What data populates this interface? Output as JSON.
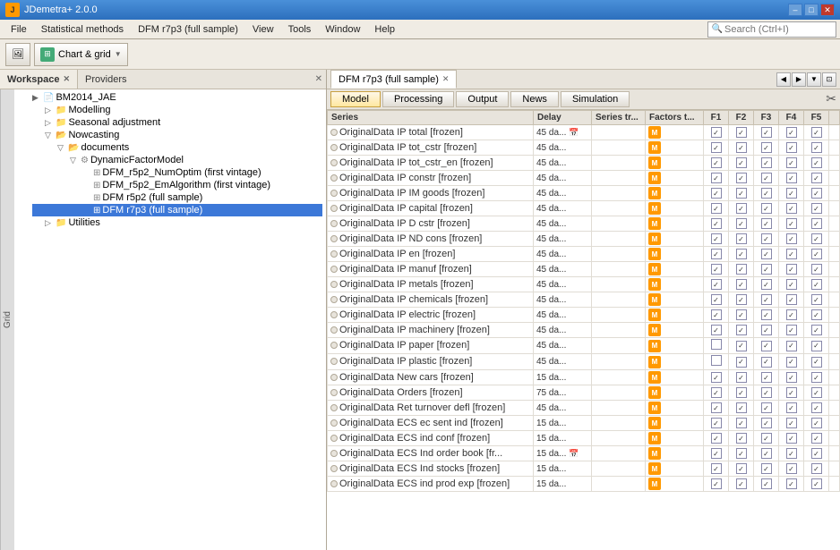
{
  "titleBar": {
    "title": "JDemetra+ 2.0.0",
    "minLabel": "–",
    "maxLabel": "□",
    "closeLabel": "✕"
  },
  "menuBar": {
    "items": [
      "File",
      "Statistical methods",
      "DFM r7p3 (full sample)",
      "View",
      "Tools",
      "Window",
      "Help"
    ],
    "searchPlaceholder": "Search (Ctrl+I)"
  },
  "toolbar": {
    "btnLabel": "Chart & grid",
    "dropdownArrow": "▼"
  },
  "leftPanel": {
    "tab1": "Workspace",
    "tab2": "Providers",
    "gridLabel": "Grid",
    "tree": [
      {
        "id": "bm2014",
        "label": "BM2014_JAE",
        "level": 0,
        "type": "folder",
        "expanded": true
      },
      {
        "id": "modelling",
        "label": "Modelling",
        "level": 1,
        "type": "folder",
        "expanded": true
      },
      {
        "id": "seasonal",
        "label": "Seasonal adjustment",
        "level": 1,
        "type": "folder",
        "expanded": false
      },
      {
        "id": "nowcasting",
        "label": "Nowcasting",
        "level": 1,
        "type": "folder",
        "expanded": true
      },
      {
        "id": "documents",
        "label": "documents",
        "level": 2,
        "type": "folder",
        "expanded": true
      },
      {
        "id": "dfm",
        "label": "DynamicFactorModel",
        "level": 3,
        "type": "folder",
        "expanded": true
      },
      {
        "id": "dfm1",
        "label": "DFM_r5p2_NumOptim (first vintage)",
        "level": 4,
        "type": "doc"
      },
      {
        "id": "dfm2",
        "label": "DFM_r5p2_EmAlgorithm (first vintage)",
        "level": 4,
        "type": "doc"
      },
      {
        "id": "dfm3",
        "label": "DFM r5p2 (full sample)",
        "level": 4,
        "type": "doc"
      },
      {
        "id": "dfm4",
        "label": "DFM r7p3 (full sample)",
        "level": 4,
        "type": "doc",
        "selected": true
      },
      {
        "id": "utilities",
        "label": "Utilities",
        "level": 1,
        "type": "folder",
        "expanded": false
      }
    ]
  },
  "rightPanel": {
    "docTab": "DFM r7p3 (full sample)",
    "contentTabs": [
      "Model",
      "Processing",
      "Output",
      "News",
      "Simulation"
    ],
    "activeContentTab": "Model",
    "tableHeaders": [
      "Series",
      "Delay",
      "Series tr...",
      "Factors t...",
      "F1",
      "F2",
      "F3",
      "F4",
      "F5"
    ],
    "rows": [
      {
        "series": "OriginalData IP total [frozen]",
        "delay": "45 da...",
        "hasCal": true,
        "f1": true,
        "f2": true,
        "f3": true,
        "f4": true,
        "f5": true
      },
      {
        "series": "OriginalData IP tot_cstr [frozen]",
        "delay": "45 da...",
        "hasCal": false,
        "f1": true,
        "f2": true,
        "f3": true,
        "f4": true,
        "f5": true
      },
      {
        "series": "OriginalData IP tot_cstr_en [frozen]",
        "delay": "45 da...",
        "hasCal": false,
        "f1": true,
        "f2": true,
        "f3": true,
        "f4": true,
        "f5": true
      },
      {
        "series": "OriginalData IP constr [frozen]",
        "delay": "45 da...",
        "hasCal": false,
        "f1": true,
        "f2": true,
        "f3": true,
        "f4": true,
        "f5": true
      },
      {
        "series": "OriginalData IP IM goods [frozen]",
        "delay": "45 da...",
        "hasCal": false,
        "f1": true,
        "f2": true,
        "f3": true,
        "f4": true,
        "f5": true
      },
      {
        "series": "OriginalData IP capital [frozen]",
        "delay": "45 da...",
        "hasCal": false,
        "f1": true,
        "f2": true,
        "f3": true,
        "f4": true,
        "f5": true
      },
      {
        "series": "OriginalData IP D cstr [frozen]",
        "delay": "45 da...",
        "hasCal": false,
        "f1": true,
        "f2": true,
        "f3": true,
        "f4": true,
        "f5": true
      },
      {
        "series": "OriginalData IP ND cons [frozen]",
        "delay": "45 da...",
        "hasCal": false,
        "f1": true,
        "f2": true,
        "f3": true,
        "f4": true,
        "f5": true
      },
      {
        "series": "OriginalData IP en [frozen]",
        "delay": "45 da...",
        "hasCal": false,
        "f1": true,
        "f2": true,
        "f3": true,
        "f4": true,
        "f5": true
      },
      {
        "series": "OriginalData IP manuf [frozen]",
        "delay": "45 da...",
        "hasCal": false,
        "f1": true,
        "f2": true,
        "f3": true,
        "f4": true,
        "f5": true
      },
      {
        "series": "OriginalData IP metals [frozen]",
        "delay": "45 da...",
        "hasCal": false,
        "f1": true,
        "f2": true,
        "f3": true,
        "f4": true,
        "f5": true
      },
      {
        "series": "OriginalData IP chemicals [frozen]",
        "delay": "45 da...",
        "hasCal": false,
        "f1": true,
        "f2": true,
        "f3": true,
        "f4": true,
        "f5": true
      },
      {
        "series": "OriginalData IP electric  [frozen]",
        "delay": "45 da...",
        "hasCal": false,
        "f1": true,
        "f2": true,
        "f3": true,
        "f4": true,
        "f5": true
      },
      {
        "series": "OriginalData IP machinery [frozen]",
        "delay": "45 da...",
        "hasCal": false,
        "f1": true,
        "f2": true,
        "f3": true,
        "f4": true,
        "f5": true
      },
      {
        "series": "OriginalData IP paper [frozen]",
        "delay": "45 da...",
        "hasCal": false,
        "f1": false,
        "f2": true,
        "f3": true,
        "f4": true,
        "f5": true
      },
      {
        "series": "OriginalData IP plastic [frozen]",
        "delay": "45 da...",
        "hasCal": false,
        "f1": false,
        "f2": true,
        "f3": true,
        "f4": true,
        "f5": true
      },
      {
        "series": "OriginalData New cars [frozen]",
        "delay": "15 da...",
        "hasCal": false,
        "f1": true,
        "f2": true,
        "f3": true,
        "f4": true,
        "f5": true
      },
      {
        "series": "OriginalData Orders [frozen]",
        "delay": "75 da...",
        "hasCal": false,
        "f1": true,
        "f2": true,
        "f3": true,
        "f4": true,
        "f5": true
      },
      {
        "series": "OriginalData Ret turnover defl [frozen]",
        "delay": "45 da...",
        "hasCal": false,
        "f1": true,
        "f2": true,
        "f3": true,
        "f4": true,
        "f5": true
      },
      {
        "series": "OriginalData ECS ec sent ind [frozen]",
        "delay": "15 da...",
        "hasCal": false,
        "f1": true,
        "f2": true,
        "f3": true,
        "f4": true,
        "f5": true
      },
      {
        "series": "OriginalData ECS ind conf [frozen]",
        "delay": "15 da...",
        "hasCal": false,
        "f1": true,
        "f2": true,
        "f3": true,
        "f4": true,
        "f5": true
      },
      {
        "series": "OriginalData ECS Ind order book [fr...",
        "delay": "15 da...",
        "hasCal": true,
        "f1": true,
        "f2": true,
        "f3": true,
        "f4": true,
        "f5": true
      },
      {
        "series": "OriginalData ECS Ind stocks [frozen]",
        "delay": "15 da...",
        "hasCal": false,
        "f1": true,
        "f2": true,
        "f3": true,
        "f4": true,
        "f5": true
      },
      {
        "series": "OriginalData ECS ind prod exp [frozen]",
        "delay": "15 da...",
        "hasCal": false,
        "f1": true,
        "f2": true,
        "f3": true,
        "f4": true,
        "f5": true
      }
    ]
  }
}
